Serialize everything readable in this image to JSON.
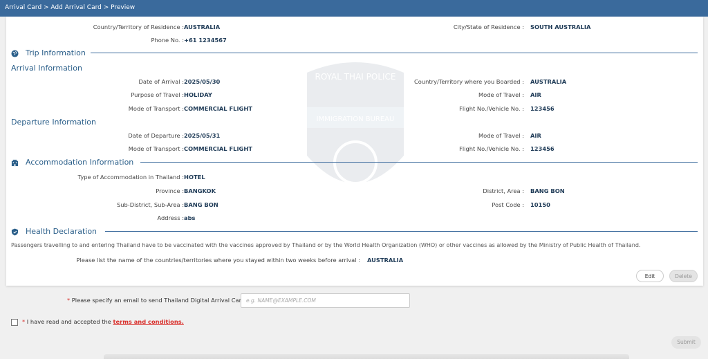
{
  "breadcrumb": "Arrival Card > Add Arrival Card > Preview",
  "residence": {
    "country_label": "Country/Territory of Residence :",
    "country_value": "AUSTRALIA",
    "city_label": "City/State of Residence :",
    "city_value": "SOUTH AUSTRALIA",
    "phone_label": "Phone No. :",
    "phone_value": "+61 1234567"
  },
  "trip": {
    "title": "Trip Information",
    "arrival_title": "Arrival Information",
    "date_arrival_label": "Date of Arrival :",
    "date_arrival_value": "2025/05/30",
    "boarded_label": "Country/Territory where you Boarded :",
    "boarded_value": "AUSTRALIA",
    "purpose_label": "Purpose of Travel :",
    "purpose_value": "HOLIDAY",
    "mode_travel_label": "Mode of Travel :",
    "mode_travel_value": "AIR",
    "transport_label": "Mode of Transport :",
    "transport_value": "COMMERCIAL FLIGHT",
    "flight_label": "Flight No./Vehicle No. :",
    "flight_value": "123456",
    "departure_title": "Departure Information",
    "date_departure_label": "Date of Departure :",
    "date_departure_value": "2025/05/31",
    "dep_mode_travel_label": "Mode of Travel :",
    "dep_mode_travel_value": "AIR",
    "dep_transport_label": "Mode of Transport :",
    "dep_transport_value": "COMMERCIAL FLIGHT",
    "dep_flight_label": "Flight No./Vehicle No. :",
    "dep_flight_value": "123456"
  },
  "accommodation": {
    "title": "Accommodation Information",
    "type_label": "Type of Accommodation in Thailand :",
    "type_value": "HOTEL",
    "province_label": "Province :",
    "province_value": "BANGKOK",
    "district_label": "District, Area :",
    "district_value": "BANG BON",
    "subdistrict_label": "Sub-District, Sub-Area :",
    "subdistrict_value": "BANG BON",
    "postcode_label": "Post Code :",
    "postcode_value": "10150",
    "address_label": "Address :",
    "address_value": "abs"
  },
  "health": {
    "title": "Health Declaration",
    "note": "Passengers travelling to and entering Thailand have to be vaccinated with the vaccines approved by Thailand or by the World Health Organization (WHO) or other vaccines as allowed by the Ministry of Public Health of Thailand.",
    "countries_label": "Please list the name of the countries/territories where you stayed within two weeks before arrival :",
    "countries_value": "AUSTRALIA"
  },
  "watermark": {
    "top_text": "ROYAL THAI POLICE",
    "band_text": "IMMIGRATION BUREAU"
  },
  "buttons": {
    "edit": "Edit",
    "delete": "Delete",
    "submit": "Submit"
  },
  "email": {
    "required_mark": "*",
    "label": "Please specify an email to send Thailand Digital Arrival Card",
    "placeholder": "e.g. NAME@EXAMPLE.COM",
    "value": ""
  },
  "terms": {
    "required_mark": "*",
    "prefix": "I have read and accepted the",
    "link": "terms and conditions."
  },
  "colors": {
    "header_bar": "#3a6a9c",
    "section_text": "#2b5f8a",
    "value_text": "#1f3b57",
    "required": "#d9302c"
  },
  "icons": {
    "trip": "globe-icon",
    "accommodation": "building-icon",
    "health": "shield-icon",
    "terms": "checkbox"
  }
}
